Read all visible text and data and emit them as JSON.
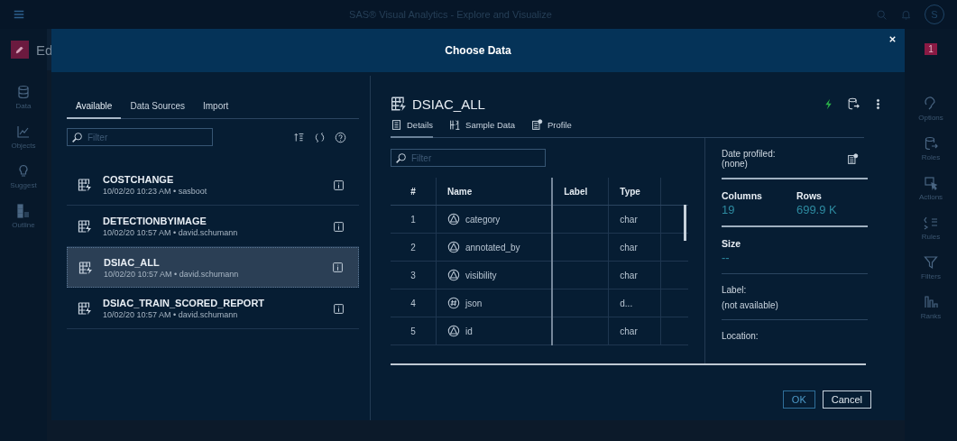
{
  "app": {
    "title": "SAS® Visual Analytics - Explore and Visualize",
    "avatar": "S",
    "report_title": "Ed",
    "badge": "1",
    "left_rail": [
      {
        "label": "Data",
        "kind": "data"
      },
      {
        "label": "Objects",
        "kind": "objects"
      },
      {
        "label": "Suggest",
        "kind": "suggest"
      },
      {
        "label": "Outline",
        "kind": "outline"
      }
    ],
    "right_rail": [
      {
        "label": "Options",
        "kind": "options"
      },
      {
        "label": "Roles",
        "kind": "roles"
      },
      {
        "label": "Actions",
        "kind": "actions"
      },
      {
        "label": "Rules",
        "kind": "rules"
      },
      {
        "label": "Filters",
        "kind": "filters"
      },
      {
        "label": "Ranks",
        "kind": "ranks"
      }
    ]
  },
  "dialog": {
    "title": "Choose Data",
    "tabs": [
      {
        "label": "Available",
        "selected": true
      },
      {
        "label": "Data Sources",
        "selected": false
      },
      {
        "label": "Import",
        "selected": false
      }
    ],
    "filter": {
      "placeholder": "Filter"
    },
    "tables": [
      {
        "name": "COSTCHANGE",
        "meta": "10/02/20 10:23 AM • sasboot",
        "selected": false
      },
      {
        "name": "DETECTIONBYIMAGE",
        "meta": "10/02/20 10:57 AM • david.schumann",
        "selected": false
      },
      {
        "name": "DSIAC_ALL",
        "meta": "10/02/20 10:57 AM • david.schumann",
        "selected": true
      },
      {
        "name": "DSIAC_TRAIN_SCORED_REPORT",
        "meta": "10/02/20 10:57 AM • david.schumann",
        "selected": false
      }
    ],
    "detail": {
      "title": "DSIAC_ALL",
      "tabs": [
        {
          "label": "Details",
          "kind": "details",
          "selected": true
        },
        {
          "label": "Sample Data",
          "kind": "sample",
          "selected": false
        },
        {
          "label": "Profile",
          "kind": "profile",
          "selected": false
        }
      ],
      "filter": {
        "placeholder": "Filter"
      },
      "columns": [
        "#",
        "Name",
        "Label",
        "Type"
      ],
      "rows": [
        {
          "number": "1",
          "name": "category",
          "kind": "character",
          "type": "char"
        },
        {
          "number": "2",
          "name": "annotated_by",
          "kind": "character",
          "type": "char"
        },
        {
          "number": "3",
          "name": "visibility",
          "kind": "character",
          "type": "char"
        },
        {
          "number": "4",
          "name": "json",
          "kind": "numeric",
          "type": "d..."
        },
        {
          "number": "5",
          "name": "id",
          "kind": "character",
          "type": "char"
        }
      ],
      "info": {
        "date_profiled_label": "Date profiled:",
        "date_profiled": "(none)",
        "columns_label": "Columns",
        "columns": "19",
        "rows_label": "Rows",
        "rows": "699.9 K",
        "size_label": "Size",
        "size": "--",
        "label_label": "Label:",
        "label": "(not available)",
        "location_label": "Location:"
      }
    },
    "buttons": [
      {
        "label": "OK",
        "kind": "primary"
      },
      {
        "label": "Cancel",
        "kind": "secondary"
      }
    ]
  }
}
